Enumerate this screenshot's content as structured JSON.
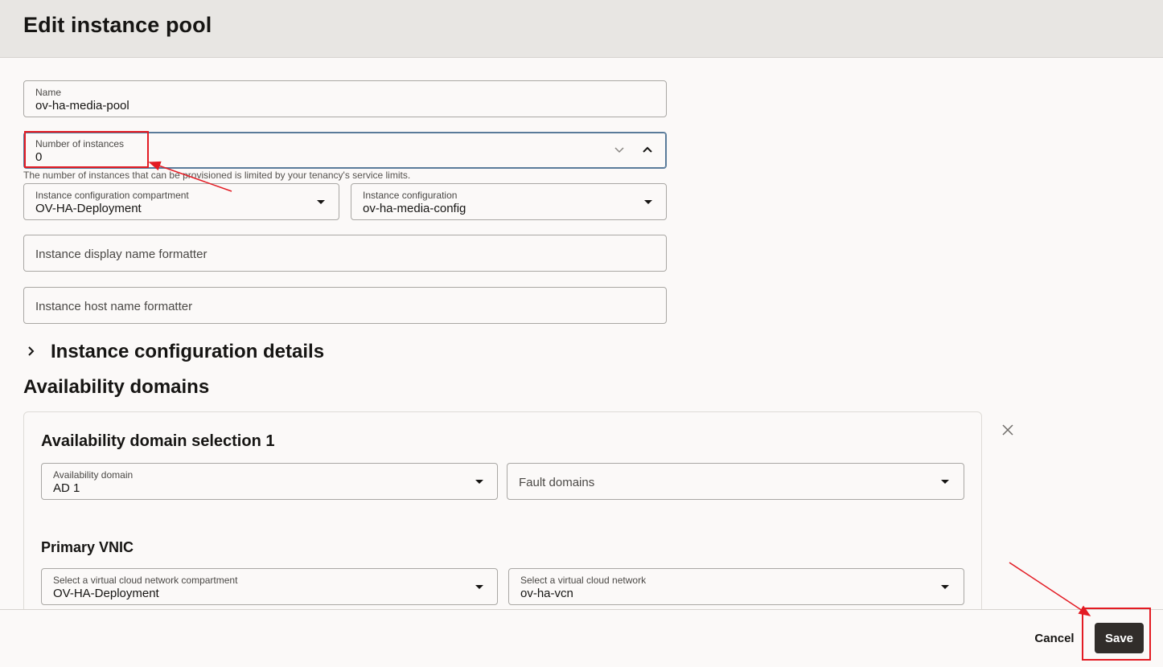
{
  "page": {
    "title": "Edit instance pool"
  },
  "form": {
    "name": {
      "label": "Name",
      "value": "ov-ha-media-pool"
    },
    "instances": {
      "label": "Number of instances",
      "value": "0",
      "helper": "The number of instances that can be provisioned is limited by your tenancy's service limits."
    },
    "config_compartment": {
      "label": "Instance configuration compartment",
      "value": "OV-HA-Deployment"
    },
    "instance_config": {
      "label": "Instance configuration",
      "value": "ov-ha-media-config"
    },
    "display_name_formatter": {
      "placeholder": "Instance display name formatter"
    },
    "host_name_formatter": {
      "placeholder": "Instance host name formatter"
    }
  },
  "sections": {
    "config_details": "Instance configuration details",
    "availability_domains": "Availability domains"
  },
  "ad_card": {
    "title": "Availability domain selection 1",
    "availability_domain": {
      "label": "Availability domain",
      "value": "AD 1"
    },
    "fault_domains": {
      "placeholder": "Fault domains"
    },
    "primary_vnic": "Primary VNIC",
    "vcn_compartment": {
      "label": "Select a virtual cloud network compartment",
      "value": "OV-HA-Deployment"
    },
    "vcn": {
      "label": "Select a virtual cloud network",
      "value": "ov-ha-vcn"
    }
  },
  "footer": {
    "cancel_label": "Cancel",
    "save_label": "Save"
  },
  "colors": {
    "primary_button": "#312d2a",
    "annotation": "#e31b23",
    "focus": "#5a7b9a"
  }
}
